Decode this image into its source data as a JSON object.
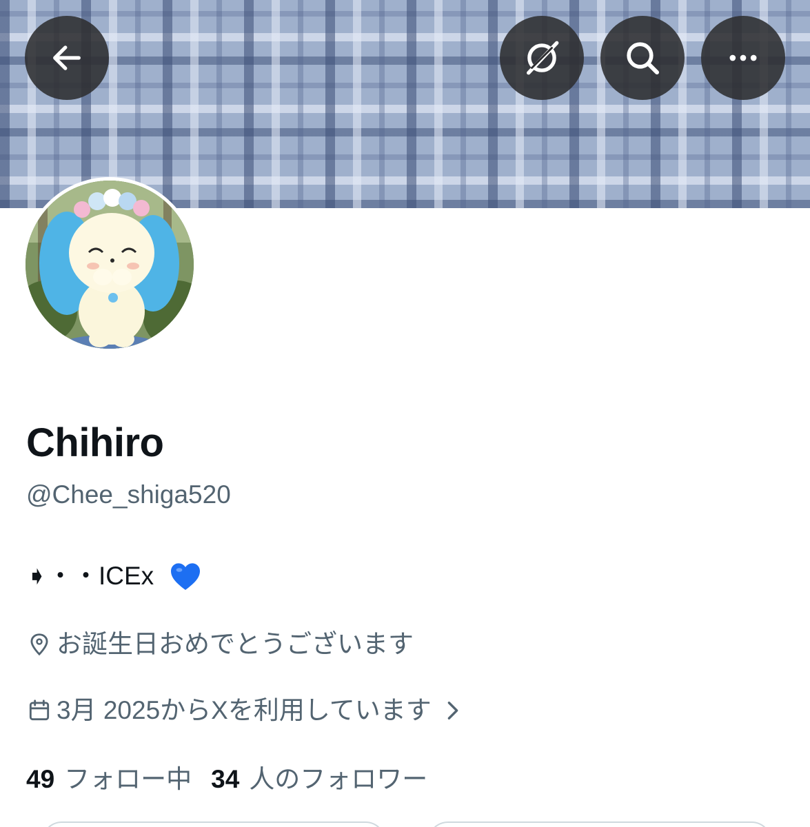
{
  "header": {
    "back_label": "",
    "icons": [
      "back-arrow-icon",
      "grok-icon",
      "search-icon",
      "more-icon"
    ]
  },
  "profile": {
    "display_name": "Chihiro",
    "handle": "@Chee_shiga520",
    "bio_text": "➧・・ICEx",
    "bio_emoji": "blue-heart",
    "location": "お誕生日おめでとうございます",
    "joined": "3月 2025からXを利用しています"
  },
  "stats": {
    "following_count": "49",
    "following_label": "フォロー中",
    "followers_count": "34",
    "followers_label": "人のフォロワー"
  },
  "colors": {
    "text_primary": "#0f1419",
    "text_secondary": "#536471",
    "heart_blue": "#1d6ff2",
    "button_overlay": "#2d2d30"
  }
}
